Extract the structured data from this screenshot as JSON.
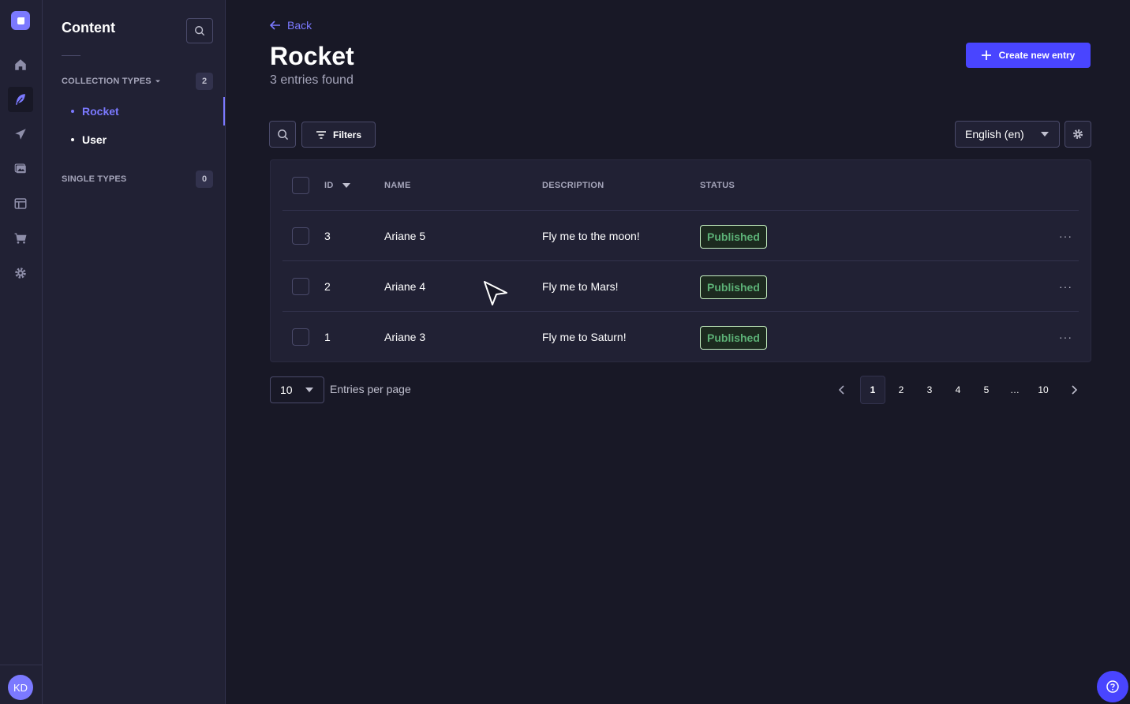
{
  "app": {
    "avatar_initials": "KD",
    "accent_color": "#4945ff",
    "link_color": "#7b79ff",
    "status_color": "#5cb176"
  },
  "rail": {
    "items": [
      {
        "icon": "home-icon"
      },
      {
        "icon": "feather-icon",
        "active": true
      },
      {
        "icon": "paper-plane-icon"
      },
      {
        "icon": "media-library-icon"
      },
      {
        "icon": "layout-icon"
      },
      {
        "icon": "cart-icon"
      },
      {
        "icon": "gear-icon"
      }
    ]
  },
  "subnav": {
    "title": "Content",
    "collection_types": {
      "label": "COLLECTION TYPES",
      "count": "2",
      "items": [
        "Rocket",
        "User"
      ],
      "active": "Rocket"
    },
    "single_types": {
      "label": "SINGLE TYPES",
      "count": "0"
    }
  },
  "header": {
    "back_label": "Back",
    "title": "Rocket",
    "subtitle": "3 entries found",
    "create_label": "Create new entry"
  },
  "toolbar": {
    "filters_label": "Filters",
    "locale_value": "English (en)"
  },
  "table": {
    "columns": [
      "ID",
      "NAME",
      "DESCRIPTION",
      "STATUS"
    ],
    "sort_column": "ID",
    "rows": [
      {
        "id": "3",
        "name": "Ariane 5",
        "description": "Fly me to the moon!",
        "status": "Published"
      },
      {
        "id": "2",
        "name": "Ariane 4",
        "description": "Fly me to Mars!",
        "status": "Published"
      },
      {
        "id": "1",
        "name": "Ariane 3",
        "description": "Fly me to Saturn!",
        "status": "Published"
      }
    ],
    "row_menu_label": "···"
  },
  "pagination": {
    "per_page_value": "10",
    "per_page_label": "Entries per page",
    "pages": [
      "1",
      "2",
      "3",
      "4",
      "5",
      "…",
      "10"
    ],
    "current_page": "1"
  }
}
